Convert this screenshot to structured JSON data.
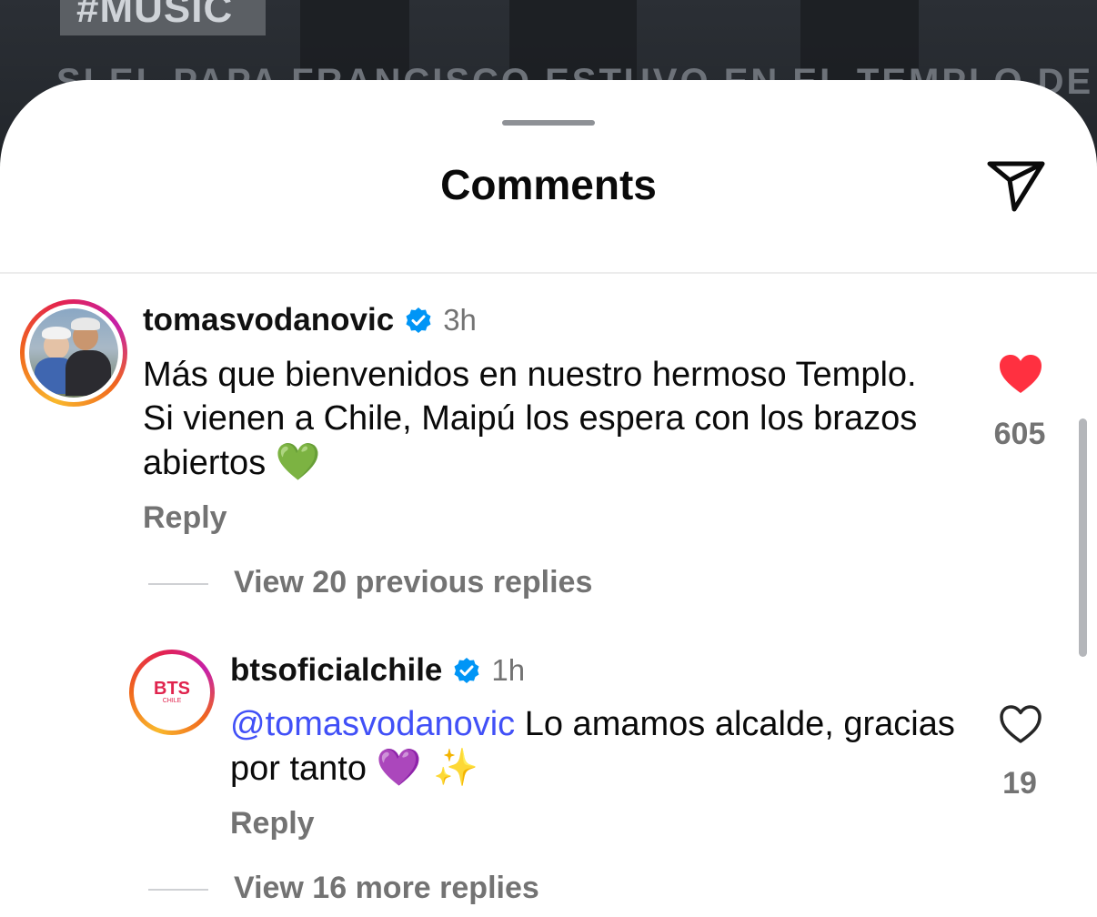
{
  "background": {
    "hashtag": "#MUSIC",
    "headline": "SI EL PAPA FRANCISCO ESTUVO EN EL TEMPLO DE"
  },
  "sheet": {
    "title": "Comments"
  },
  "comments": [
    {
      "username": "tomasvodanovic",
      "verified": true,
      "time": "3h",
      "text": "Más que bienvenidos en nuestro hermoso Templo. Si vienen a Chile, Maipú los espera con los brazos abiertos",
      "emoji": "💚",
      "reply_label": "Reply",
      "liked": true,
      "likes": "605",
      "view_replies": "View 20 previous replies"
    },
    {
      "username": "btsoficialchile",
      "verified": true,
      "time": "1h",
      "mention": "@tomasvodanovic",
      "text": "Lo amamos alcalde, gracias por tanto",
      "emoji": "💜 ✨",
      "reply_label": "Reply",
      "liked": false,
      "likes": "19",
      "view_replies": "View 16 more replies",
      "avatar_text": "BTS",
      "avatar_subtext": "CHILE"
    }
  ],
  "colors": {
    "like_red": "#ff3040",
    "verified_blue": "#0095f6",
    "mention_blue": "#4150f7",
    "secondary_text": "#737373"
  }
}
